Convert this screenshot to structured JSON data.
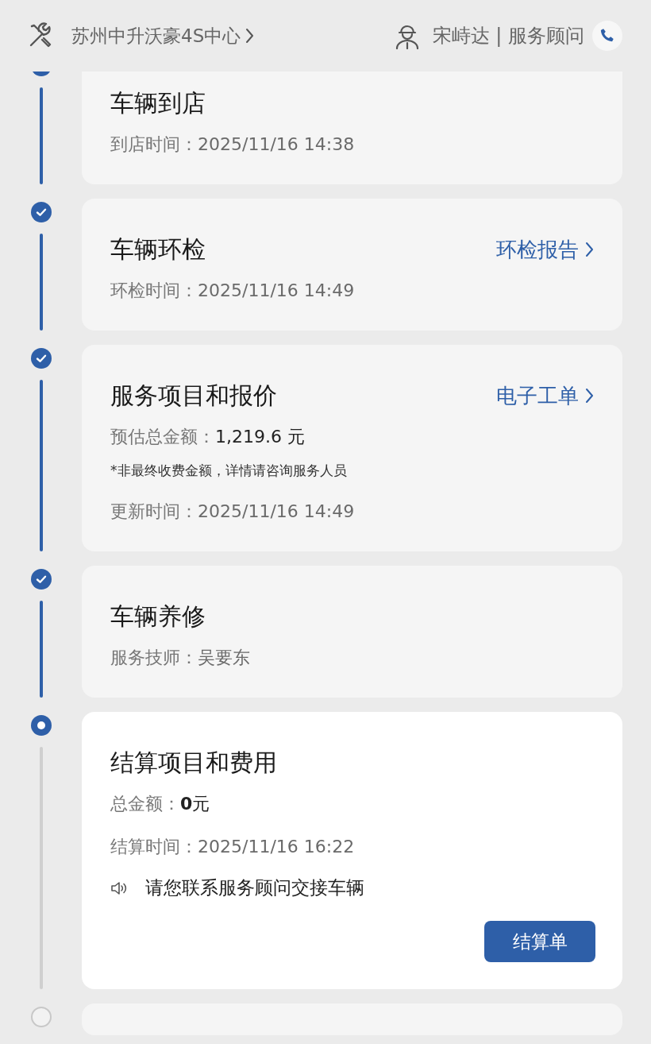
{
  "header": {
    "dealer": "苏州中升沃豪4S中心",
    "advisor": "宋峙达 | 服务顾问"
  },
  "steps": [
    {
      "completed": true,
      "active": false,
      "title": "车辆到店",
      "fields": [
        {
          "kind": "plain",
          "label": "到店时间：",
          "value": "2025/11/16 14:38"
        }
      ]
    },
    {
      "completed": true,
      "active": false,
      "title": "车辆环检",
      "link": "环检报告",
      "fields": [
        {
          "kind": "plain",
          "label": "环检时间：",
          "value": "2025/11/16 14:49"
        }
      ]
    },
    {
      "completed": true,
      "active": false,
      "title": "服务项目和报价",
      "link": "电子工单",
      "fields": [
        {
          "kind": "amount",
          "label": "预估总金额：",
          "value": "1,219.6 元"
        },
        {
          "kind": "note",
          "value": "*非最终收费金额，详情请咨询服务人员"
        },
        {
          "kind": "plain",
          "label": "更新时间：",
          "value": "2025/11/16 14:49"
        }
      ]
    },
    {
      "completed": true,
      "active": false,
      "title": "车辆养修",
      "fields": [
        {
          "kind": "plain",
          "label": "服务技师：",
          "value": "吴要东"
        }
      ]
    },
    {
      "completed": false,
      "active": true,
      "title": "结算项目和费用",
      "fields": [
        {
          "kind": "amount",
          "label": "总金额：",
          "value": "**0**元"
        },
        {
          "kind": "plain",
          "label": "结算时间：",
          "value": "2025/11/16 16:22"
        },
        {
          "kind": "notice",
          "value": "请您联系服务顾问交接车辆"
        }
      ],
      "button": "结算单"
    },
    {
      "completed": false,
      "active": false
    }
  ]
}
